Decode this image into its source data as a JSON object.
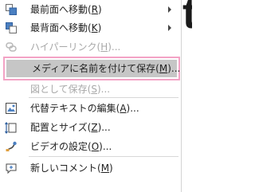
{
  "background": {
    "glyph": "t"
  },
  "colors": {
    "highlight_border": "#f3a3c5",
    "hover_fill": "#c6c6c6",
    "disabled_text": "#a8a8a8"
  },
  "menu": {
    "items": [
      {
        "label": "最前面へ移動(R)",
        "icon": "bring-to-front-icon",
        "submenu": true,
        "disabled": false
      },
      {
        "label": "最背面へ移動(K)",
        "icon": "send-to-back-icon",
        "submenu": true,
        "disabled": false
      },
      {
        "label": "ハイパーリンク(H)...",
        "icon": "hyperlink-icon",
        "submenu": false,
        "disabled": true
      },
      {
        "label": "メディアに名前を付けて保存(M)...",
        "icon": "",
        "submenu": false,
        "disabled": false,
        "highlighted": true
      },
      {
        "label": "図として保存(S)...",
        "icon": "",
        "submenu": false,
        "disabled": true
      },
      {
        "label": "代替テキストの編集(A)...",
        "icon": "alt-text-icon",
        "submenu": false,
        "disabled": false
      },
      {
        "label": "配置とサイズ(Z)...",
        "icon": "size-position-icon",
        "submenu": false,
        "disabled": false
      },
      {
        "label": "ビデオの設定(O)...",
        "icon": "video-settings-icon",
        "submenu": false,
        "disabled": false
      },
      {
        "label": "新しいコメント(M)",
        "icon": "new-comment-icon",
        "submenu": false,
        "disabled": false
      }
    ]
  }
}
